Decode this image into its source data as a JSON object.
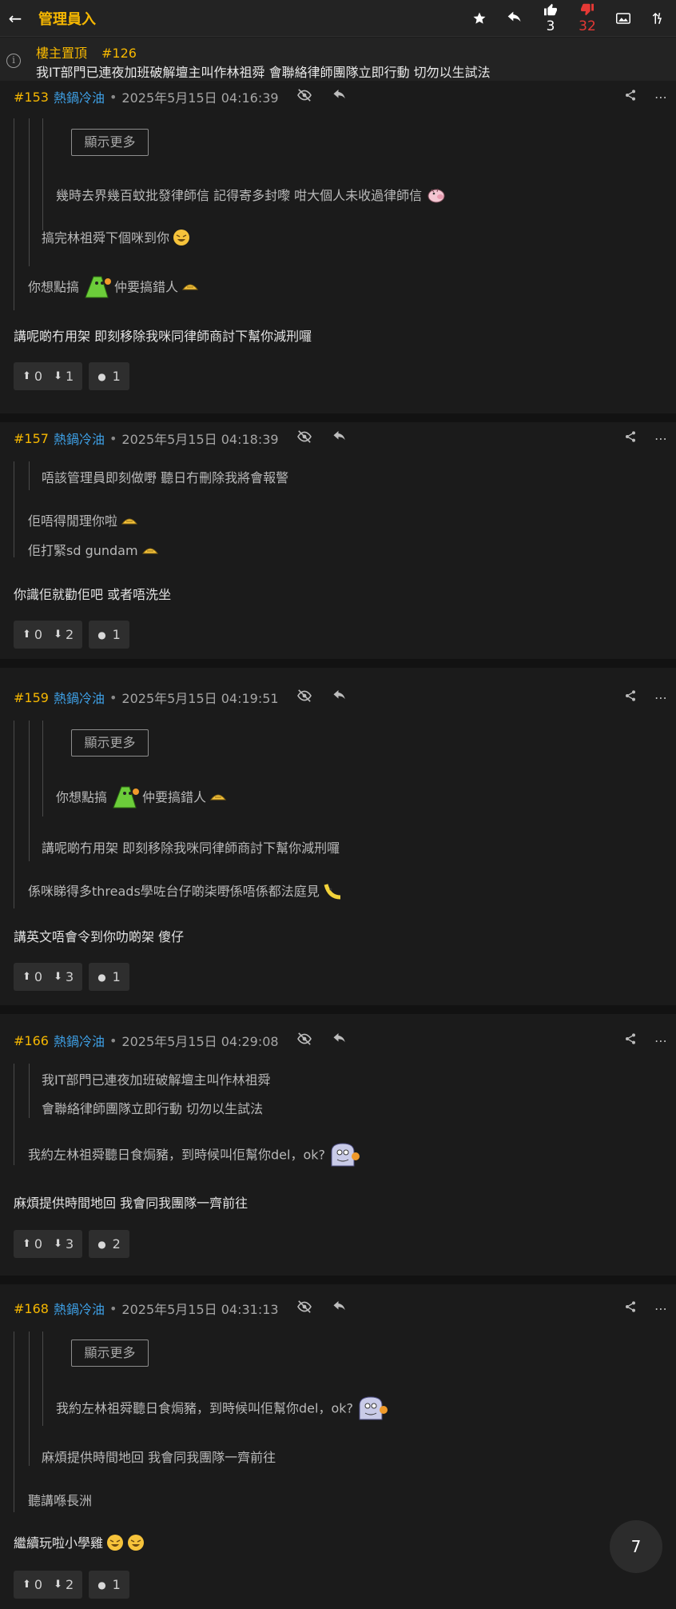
{
  "header": {
    "title": "管理員入",
    "up_count": "3",
    "down_count": "32"
  },
  "pinned": {
    "label": "樓主置頂",
    "number": "#126",
    "text": "我IT部門已連夜加班破解壇主叫作林祖舜 會聯絡律師團隊立即行動 切勿以生試法"
  },
  "show_more_label": "顯示更多",
  "posts": [
    {
      "id": "#153",
      "user": "熱鍋冷油",
      "time": "2025年5月15日 04:16:39",
      "q3": "幾時去界幾百蚊批發律師信 記得寄多封嚟 咁大個人未收過律師信",
      "q2": "搞完林祖舜下個咪到你",
      "q1a": "你想點搞",
      "q1b": "仲要搞錯人",
      "body": "講呢啲冇用架 即刻移除我咪同律師商討下幫你減刑囉",
      "up": "0",
      "down": "1",
      "replies": "1"
    },
    {
      "id": "#157",
      "user": "熱鍋冷油",
      "time": "2025年5月15日 04:18:39",
      "q2": "唔該管理員即刻做嘢 聽日冇刪除我將會報警",
      "q1a": "佢唔得閒理你啦",
      "q1b": "佢打緊sd gundam",
      "body": "你識佢就勸佢吧 或者唔洗坐",
      "up": "0",
      "down": "2",
      "replies": "1"
    },
    {
      "id": "#159",
      "user": "熱鍋冷油",
      "time": "2025年5月15日 04:19:51",
      "q3a": "你想點搞",
      "q3b": "仲要搞錯人",
      "q2": "講呢啲冇用架 即刻移除我咪同律師商討下幫你減刑囉",
      "q1": "係咪睇得多threads學咗台仔啲柒嘢係唔係都法庭見",
      "body": "講英文唔會令到你叻啲架 傻仔",
      "up": "0",
      "down": "3",
      "replies": "1"
    },
    {
      "id": "#166",
      "user": "熱鍋冷油",
      "time": "2025年5月15日 04:29:08",
      "q2a": "我IT部門已連夜加班破解壇主叫作林祖舜",
      "q2b": "會聯絡律師團隊立即行動 切勿以生試法",
      "q1": "我約左林祖舜聽日食焗豬，到時候叫佢幫你del，ok?",
      "body": "麻煩提供時間地回 我會同我團隊一齊前往",
      "up": "0",
      "down": "3",
      "replies": "2"
    },
    {
      "id": "#168",
      "user": "熱鍋冷油",
      "time": "2025年5月15日 04:31:13",
      "q3": "我約左林祖舜聽日食焗豬，到時候叫佢幫你del，ok?",
      "q2": "麻煩提供時間地回 我會同我團隊一齊前往",
      "q1": "聽講喺長洲",
      "body": "繼續玩啦小學雞",
      "up": "0",
      "down": "2",
      "replies": "1"
    }
  ],
  "page_number": "7",
  "colors": {
    "accent": "#f6b701",
    "username": "#3ea0e6",
    "downvote": "#e53935",
    "background": "#1b1b1b"
  }
}
